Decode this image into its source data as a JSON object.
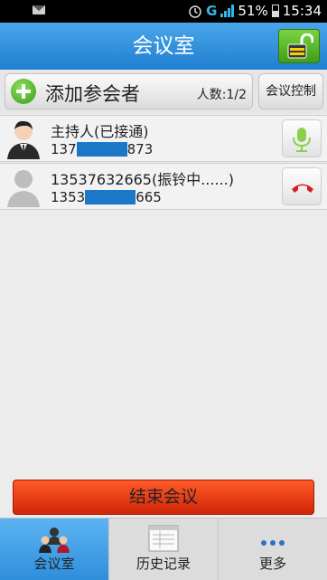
{
  "statusbar": {
    "network": "G",
    "battery": "51%",
    "time": "15:34",
    "icons": [
      "mail-icon",
      "alarm-icon",
      "signal-icon",
      "battery-icon"
    ]
  },
  "header": {
    "title": "会议室",
    "lock_icon": "unlock-icon"
  },
  "addbar": {
    "add_label": "添加参会者",
    "count": "人数:1/2",
    "control_label": "会议控制"
  },
  "participants": [
    {
      "name": "主持人(已接通)",
      "number_prefix": "137",
      "number_suffix": "873",
      "action_icon": "microphone-icon"
    },
    {
      "name": "13537632665(振铃中......)",
      "number_prefix": "1353",
      "number_suffix": "665",
      "action_icon": "hangup-icon"
    }
  ],
  "end_button": "结束会议",
  "tabs": [
    {
      "label": "会议室",
      "icon": "meeting-room-icon",
      "active": true
    },
    {
      "label": "历史记录",
      "icon": "history-icon",
      "active": false
    },
    {
      "label": "更多",
      "icon": "more-icon",
      "active": false
    }
  ],
  "colors": {
    "title_bar": "#2f8fdc",
    "end_button": "#e8360f",
    "mask": "#1b78c9",
    "lock_button": "#5cba2a"
  }
}
